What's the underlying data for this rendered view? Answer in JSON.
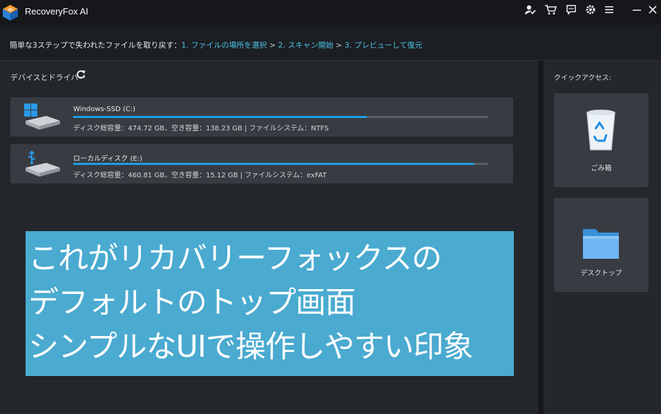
{
  "window": {
    "title": "RecoveryFox AI",
    "toolbar_icons": [
      "user-check-icon",
      "cart-icon",
      "feedback-icon",
      "settings-icon",
      "menu-icon",
      "minimize-icon",
      "close-icon"
    ]
  },
  "steps": {
    "lead": "簡単な3ステップで失われたファイルを取り戻す：",
    "step1": "1. ファイルの場所を選択",
    "sep1": " > ",
    "step2": "2. スキャン開始",
    "sep2": " > ",
    "step3": "3. プレビューして復元"
  },
  "devices": {
    "label": "デバイスとドライバー",
    "drives": [
      {
        "name": "Windows-SSD (C:)",
        "info": "ディスク総容量：474.72 GB、空き容量：138.23 GB | ファイルシステム：NTFS",
        "used_fraction": 0.709
      },
      {
        "name": "ローカルディスク (E:)",
        "info": "ディスク総容量：460.81 GB、空き容量：15.12 GB | ファイルシステム：exFAT",
        "used_fraction": 0.967
      }
    ]
  },
  "quick_access": {
    "label": "クイックアクセス:",
    "items": [
      {
        "label": "ごみ箱",
        "icon": "recycle-bin-icon"
      },
      {
        "label": "デスクトップ",
        "icon": "folder-icon"
      }
    ]
  },
  "caption": {
    "lines": [
      "これがリカバリーフォックスの",
      "デフォルトのトップ画面",
      "シンプルなUIで操作しやすい印象"
    ]
  },
  "colors": {
    "accent": "#1aa0e6",
    "step_text": "#4ec3e8",
    "caption_bg": "#4aaad0",
    "card_bg": "#383c42"
  }
}
